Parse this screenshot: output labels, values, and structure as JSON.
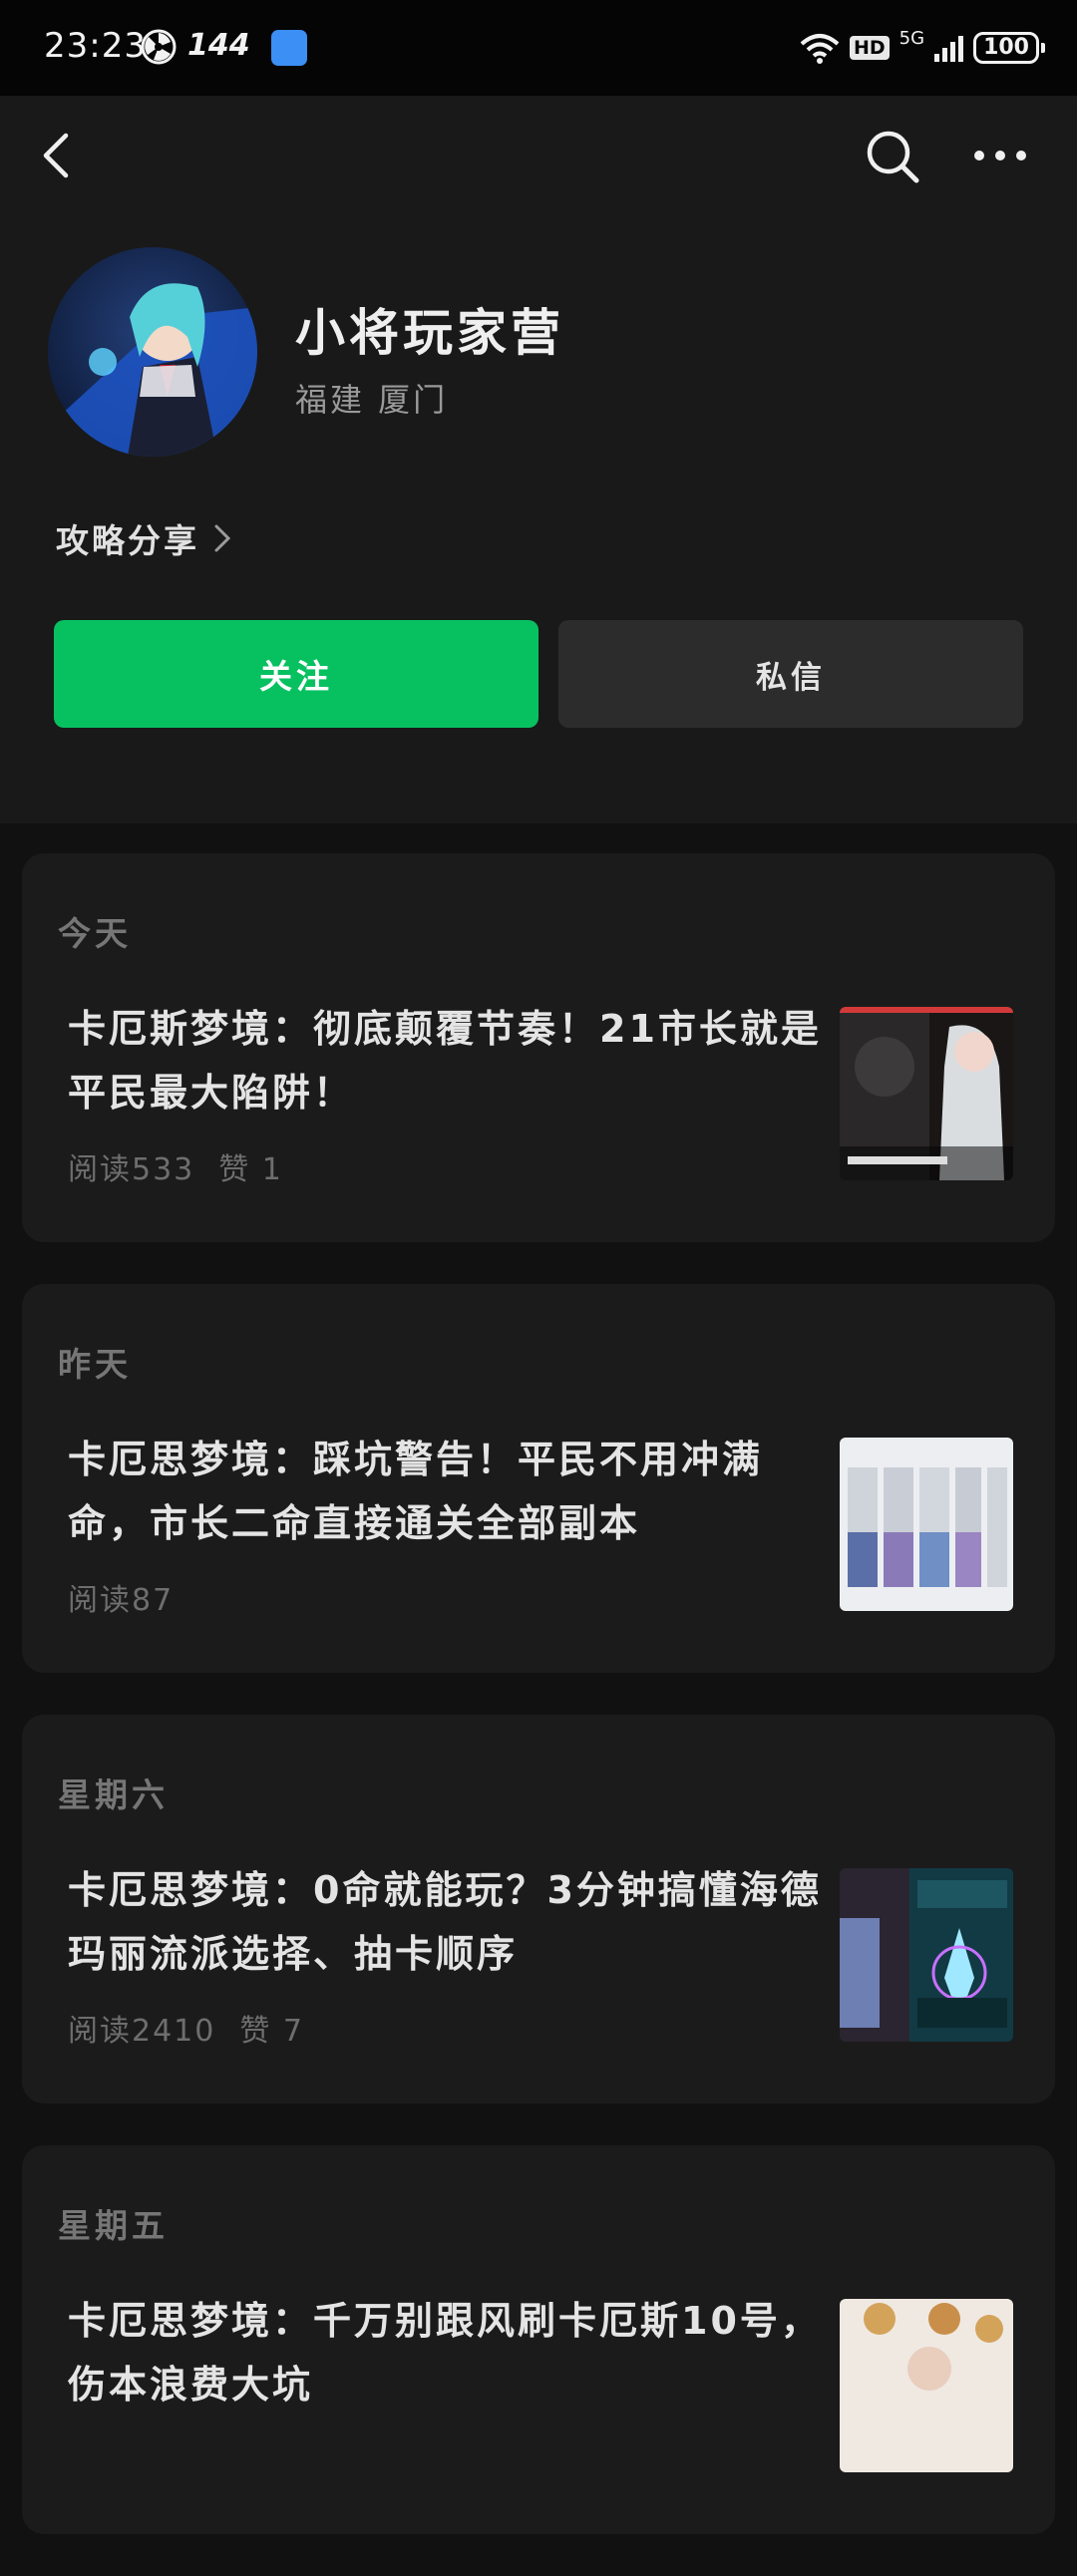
{
  "status_bar": {
    "time": "23:23",
    "refresh_rate": "144",
    "network": "5G",
    "hd": "HD",
    "battery": "100"
  },
  "nav": {
    "back_icon": "chevron-left-icon",
    "search_icon": "search-icon",
    "more_icon": "more-horizontal-icon"
  },
  "profile": {
    "name": "小将玩家营",
    "location": "福建 厦门",
    "category": "攻略分享",
    "follow_label": "关注",
    "message_label": "私信"
  },
  "colors": {
    "accent": "#07c160",
    "background": "#191919",
    "card": "#1b1b1b"
  },
  "articles": [
    {
      "day": "今天",
      "title": "卡厄斯梦境：彻底颠覆节奏！21市长就是平民最大陷阱！",
      "reads": "阅读533",
      "likes": "赞 1"
    },
    {
      "day": "昨天",
      "title": "卡厄思梦境：踩坑警告！平民不用冲满命，市长二命直接通关全部副本",
      "reads": "阅读87",
      "likes": ""
    },
    {
      "day": "星期六",
      "title": "卡厄思梦境：0命就能玩？3分钟搞懂海德玛丽流派选择、抽卡顺序",
      "reads": "阅读2410",
      "likes": "赞 7"
    },
    {
      "day": "星期五",
      "title": "卡厄思梦境：千万别跟风刷卡厄斯10号，伤本浪费大坑",
      "reads": "",
      "likes": ""
    }
  ]
}
